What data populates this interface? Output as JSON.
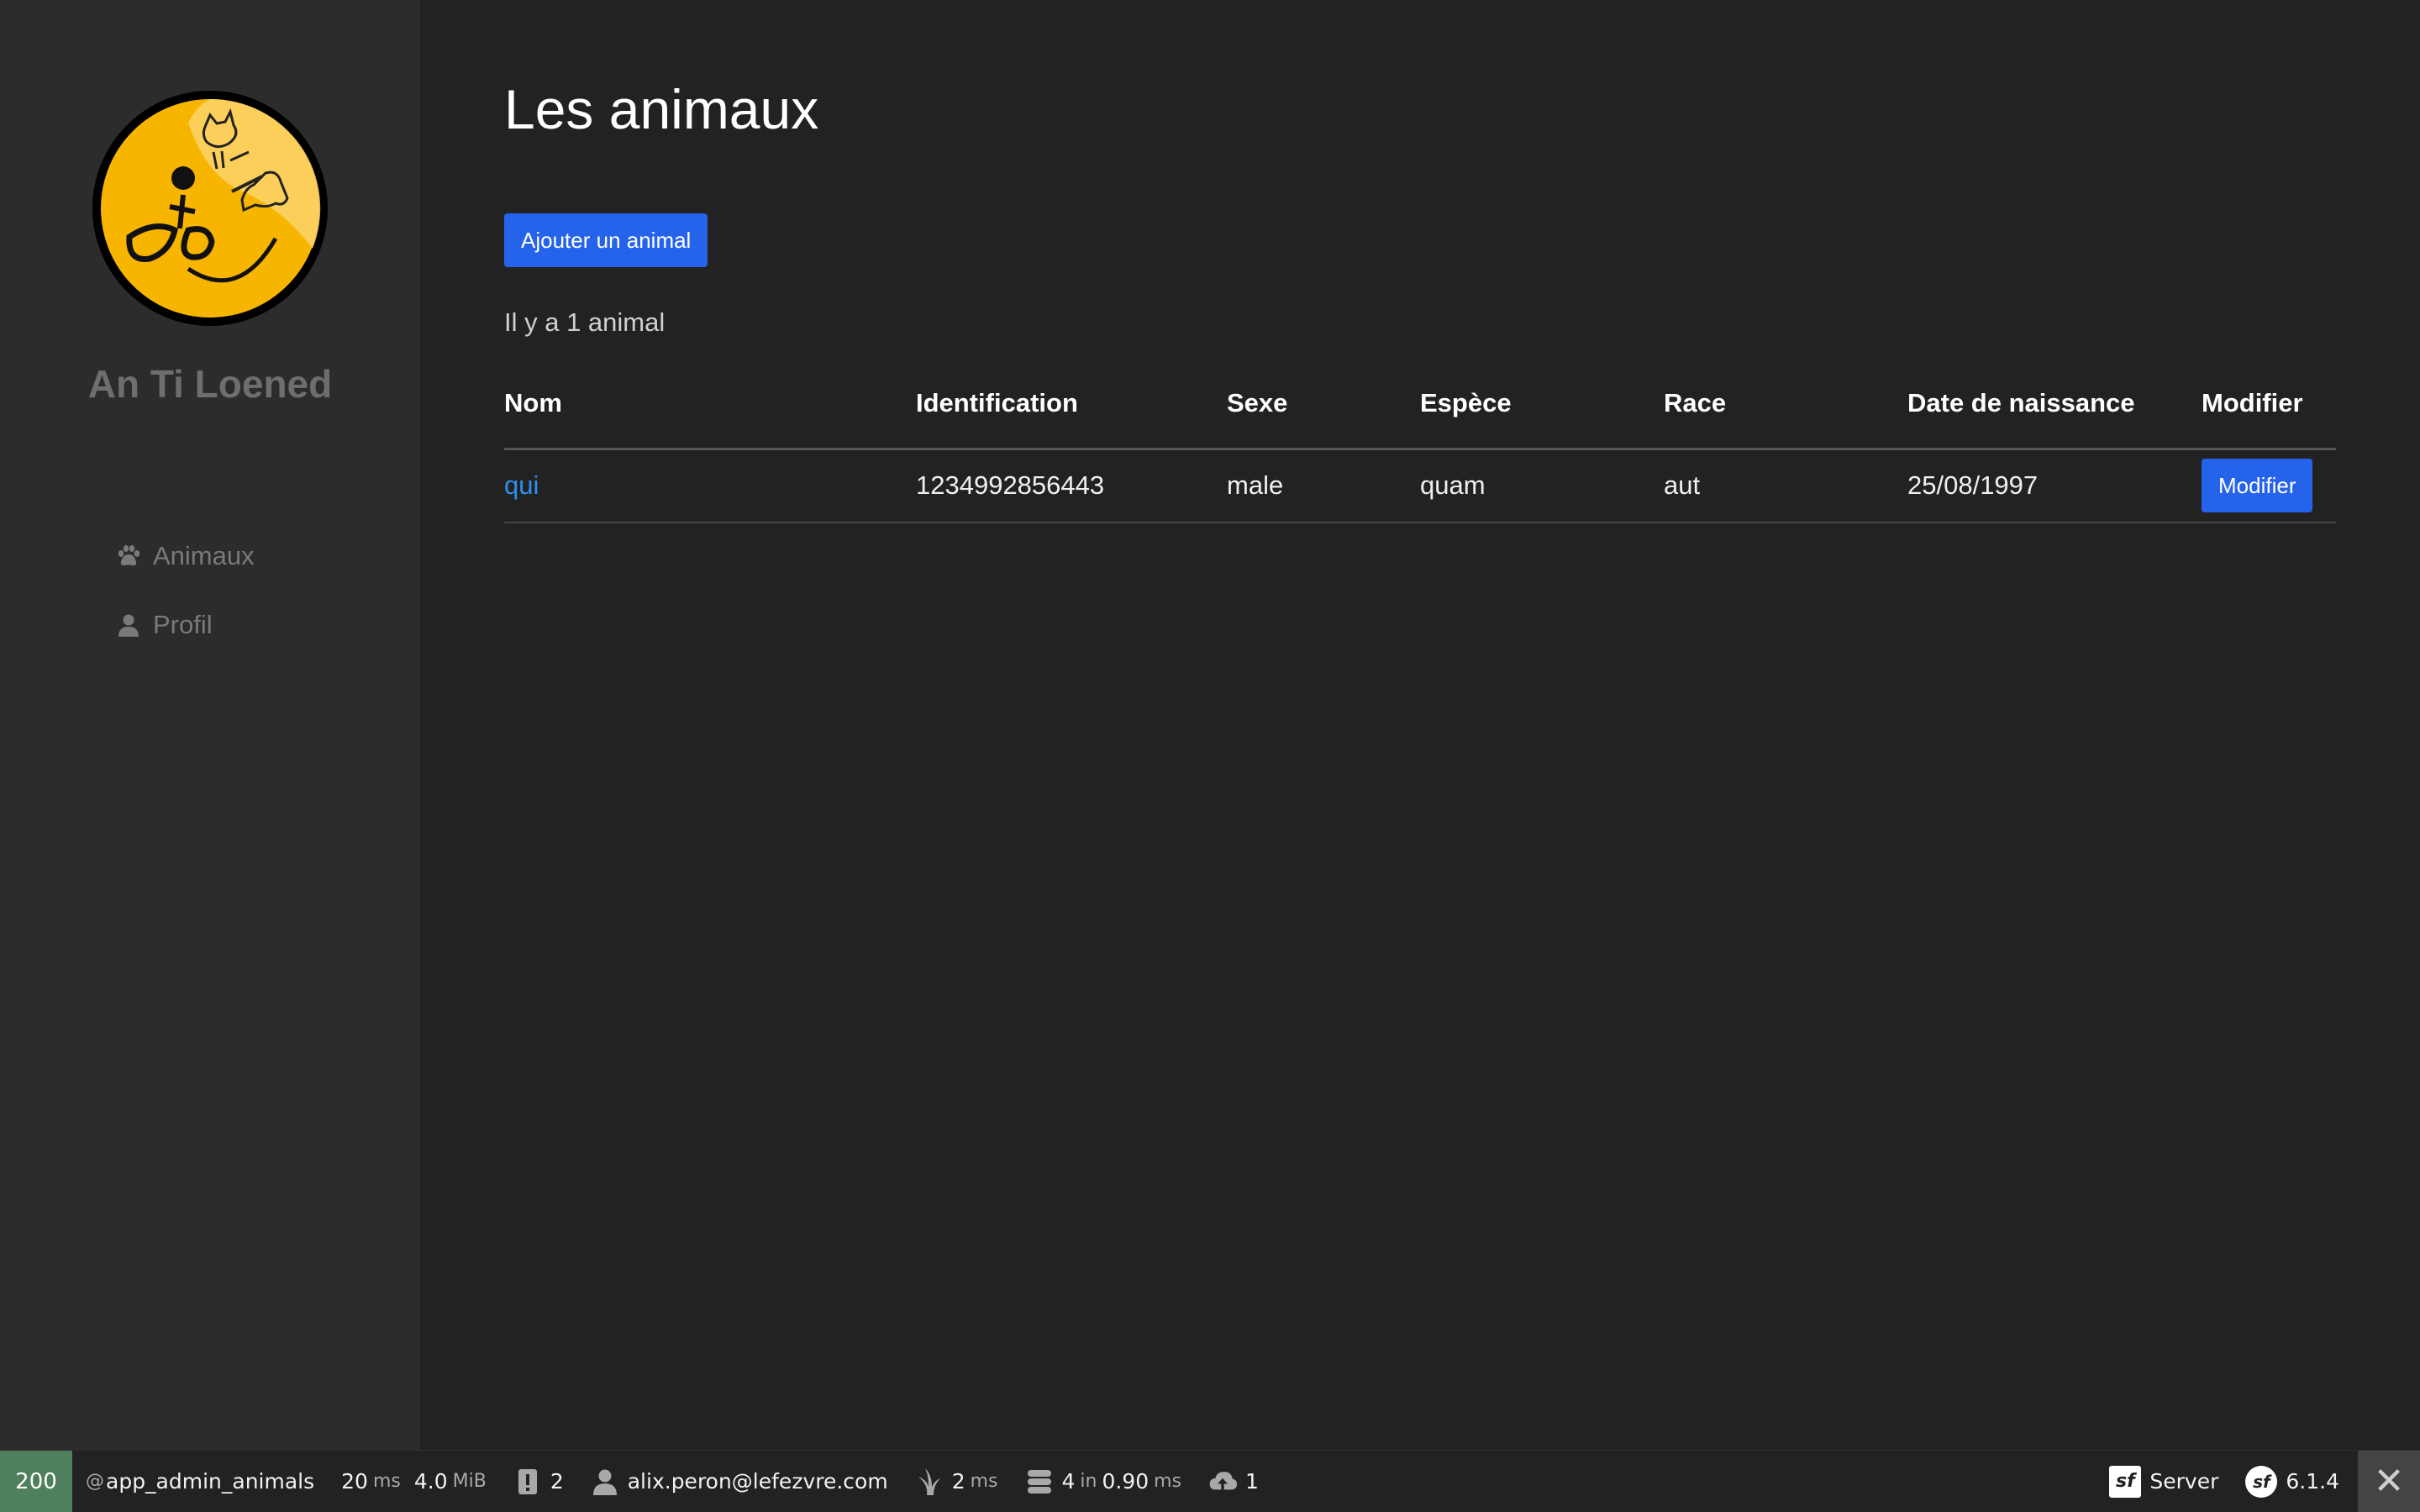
{
  "sidebar": {
    "brand": "An Ti Loened",
    "items": [
      {
        "label": "Animaux",
        "icon": "paw-icon"
      },
      {
        "label": "Profil",
        "icon": "user-icon"
      }
    ]
  },
  "main": {
    "title": "Les animaux",
    "add_button": "Ajouter un animal",
    "count_text": "Il y a 1 animal",
    "table": {
      "headers": [
        "Nom",
        "Identification",
        "Sexe",
        "Espèce",
        "Race",
        "Date de naissance",
        "Modifier"
      ],
      "rows": [
        {
          "nom": "qui",
          "identification": "1234992856443",
          "sexe": "male",
          "espece": "quam",
          "race": "aut",
          "date_naissance": "25/08/1997",
          "edit_label": "Modifier"
        }
      ]
    }
  },
  "toolbar": {
    "status": "200",
    "route_prefix": "@",
    "route": "app_admin_animals",
    "time_value": "20",
    "time_unit": "ms",
    "memory_value": "4.0",
    "memory_unit": "MiB",
    "logs_count": "2",
    "user": "alix.peron@lefezvre.com",
    "twig_value": "2",
    "twig_unit": "ms",
    "db_queries": "4",
    "db_in": "in",
    "db_time": "0.90",
    "db_unit": "ms",
    "upload_count": "1",
    "server_label": "Server",
    "version": "6.1.4",
    "close": "✕"
  },
  "colors": {
    "background": "#222222",
    "sidebar": "#2c2c2c",
    "accent": "#2563eb",
    "link": "#2f8ff0",
    "status_ok": "#4f805d",
    "logo_yellow": "#f7b500"
  }
}
